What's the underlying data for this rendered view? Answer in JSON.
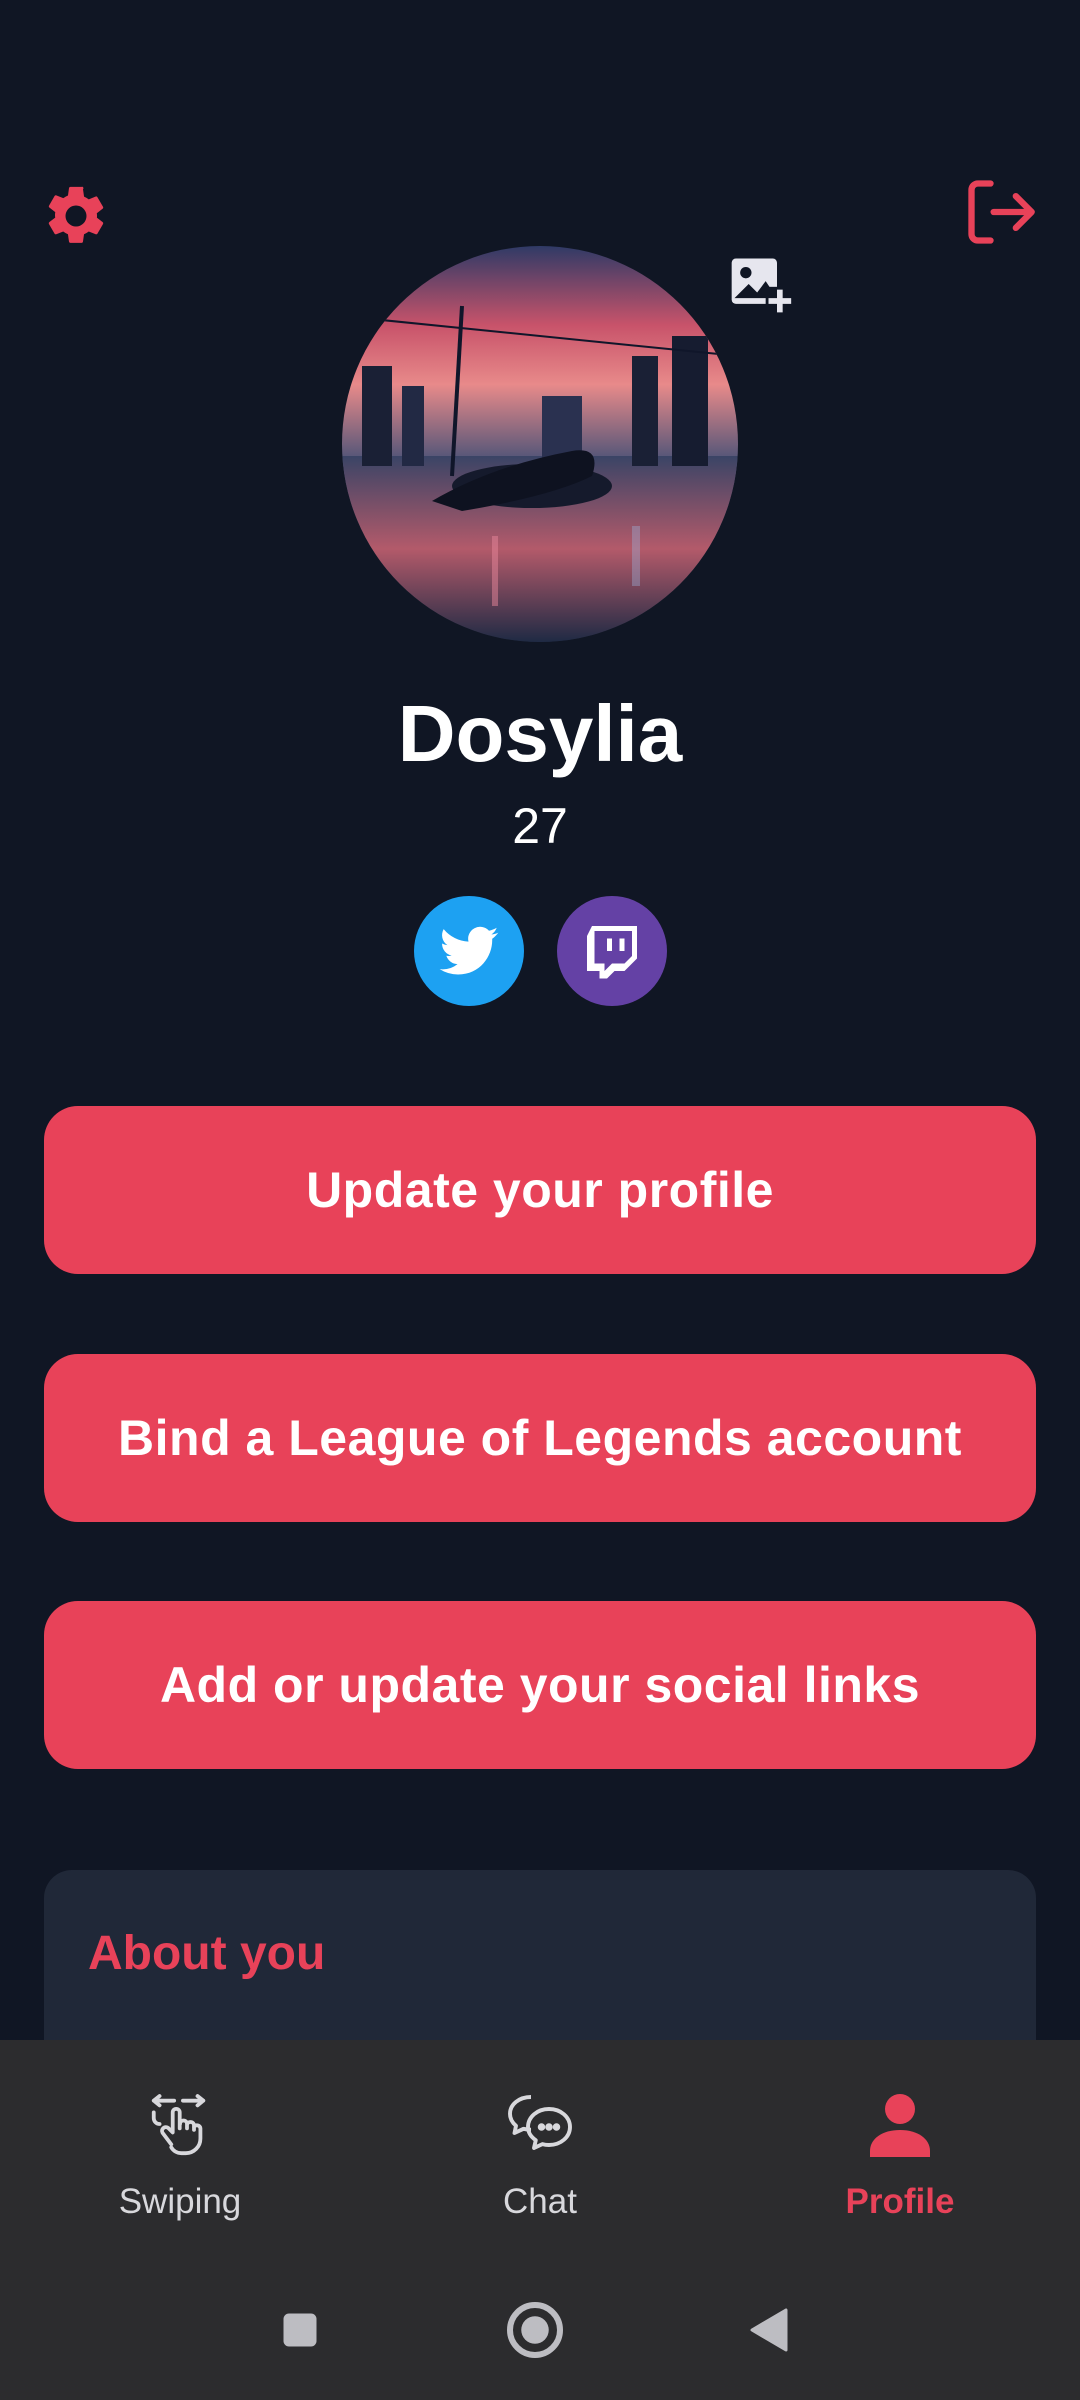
{
  "profile": {
    "name": "Dosylia",
    "age": "27"
  },
  "icons": {
    "settings": "gear-icon",
    "logout": "logout-icon",
    "add_photo": "add-photo-icon",
    "twitter": "twitter-icon",
    "twitch": "twitch-icon"
  },
  "actions": {
    "update_profile": "Update your profile",
    "bind_lol": "Bind a League of Legends account",
    "social_links": "Add or update your social links"
  },
  "about": {
    "title": "About you"
  },
  "nav": {
    "items": [
      {
        "label": "Swiping",
        "icon": "swipe-hand-icon",
        "active": false
      },
      {
        "label": "Chat",
        "icon": "chat-bubbles-icon",
        "active": false
      },
      {
        "label": "Profile",
        "icon": "person-icon",
        "active": true
      }
    ]
  },
  "colors": {
    "background": "#101624",
    "accent": "#e84259",
    "card": "#202838",
    "nav_bar": "#2c2c2e",
    "twitter": "#1da1f2",
    "twitch": "#6441a5"
  }
}
